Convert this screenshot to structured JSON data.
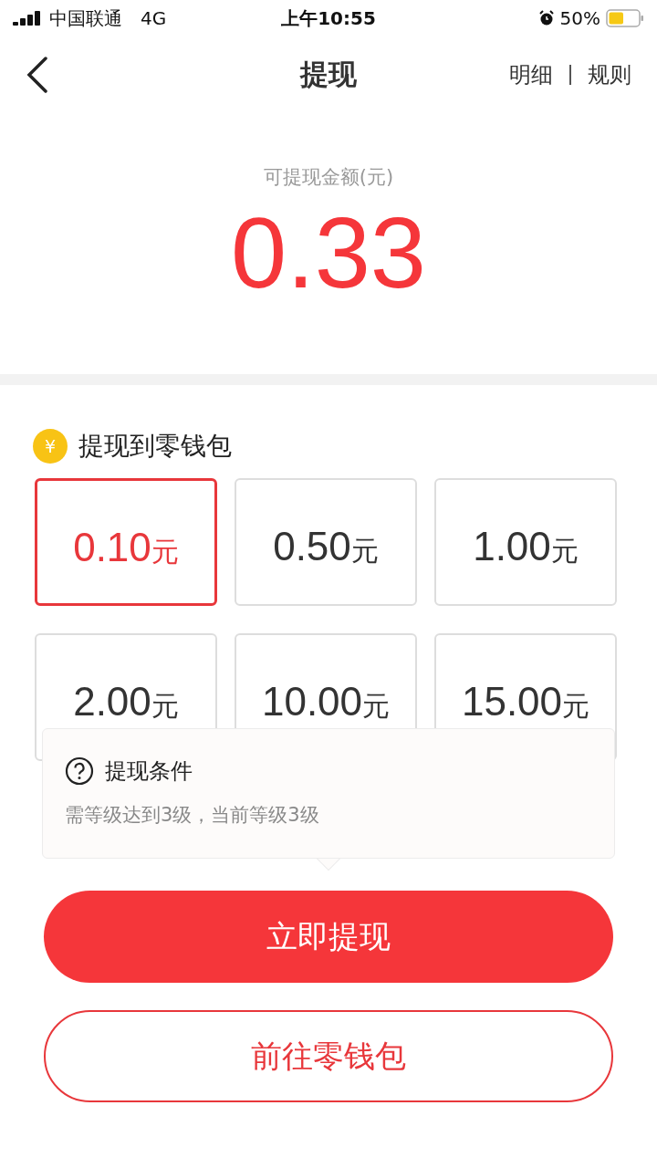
{
  "status_bar": {
    "carrier": "中国联通",
    "network": "4G",
    "time": "上午10:55",
    "battery": "50%"
  },
  "nav": {
    "title": "提现",
    "links": [
      "明细",
      "规则"
    ]
  },
  "balance": {
    "label": "可提现金额(元)",
    "amount": "0.33"
  },
  "section": {
    "coin_symbol": "¥",
    "title": "提现到零钱包"
  },
  "options": [
    {
      "amount": "0.10",
      "unit": "元",
      "selected": true
    },
    {
      "amount": "0.50",
      "unit": "元",
      "selected": false
    },
    {
      "amount": "1.00",
      "unit": "元",
      "selected": false
    },
    {
      "amount": "2.00",
      "unit": "元",
      "selected": false
    },
    {
      "amount": "10.00",
      "unit": "元",
      "selected": false
    },
    {
      "amount": "15.00",
      "unit": "元",
      "selected": false
    }
  ],
  "tooltip": {
    "title": "提现条件",
    "text": "需等级达到3级，当前等级3级"
  },
  "buttons": [
    {
      "label": "立即提现",
      "kind": "primary"
    },
    {
      "label": "前往零钱包",
      "kind": "outline"
    }
  ]
}
